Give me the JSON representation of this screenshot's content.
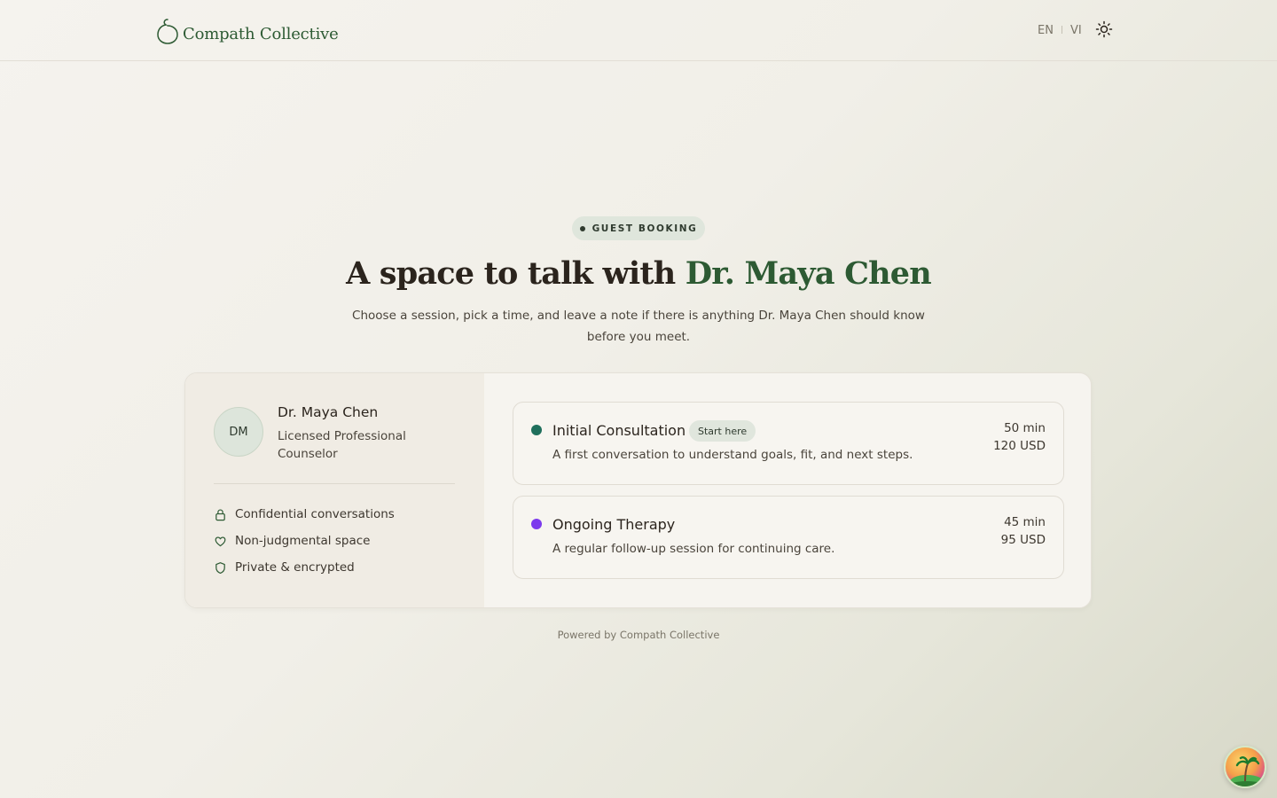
{
  "header": {
    "brand_name": "Compath Collective",
    "lang_en": "EN",
    "lang_sep": "|",
    "lang_vi": "VI",
    "theme_icon": "sun-icon"
  },
  "hero": {
    "badge": "GUEST BOOKING",
    "title_prefix": "A space to talk with ",
    "title_highlight": "Dr. Maya Chen",
    "subtitle": "Choose a session, pick a time, and leave a note if there is anything Dr. Maya Chen should know before you meet."
  },
  "counselor": {
    "initials": "DM",
    "name": "Dr. Maya Chen",
    "role": "Licensed Professional Counselor",
    "features": [
      {
        "icon": "lock-icon",
        "label": "Confidential conversations"
      },
      {
        "icon": "heart-icon",
        "label": "Non-judgmental space"
      },
      {
        "icon": "shield-icon",
        "label": "Private & encrypted"
      }
    ]
  },
  "sessions": [
    {
      "title": "Initial Consultation",
      "tag": "Start here",
      "description": "A first conversation to understand goals, fit, and next steps.",
      "duration": "50 min",
      "price": "120 USD",
      "color": "#1f6f5c"
    },
    {
      "title": "Ongoing Therapy",
      "tag": "",
      "description": "A regular follow-up session for continuing care.",
      "duration": "45 min",
      "price": "95 USD",
      "color": "#7c3aed"
    }
  ],
  "footer": {
    "powered_by": "Powered by Compath Collective"
  },
  "colors": {
    "accent": "#2d5a33",
    "background": "#f4f2ec"
  }
}
